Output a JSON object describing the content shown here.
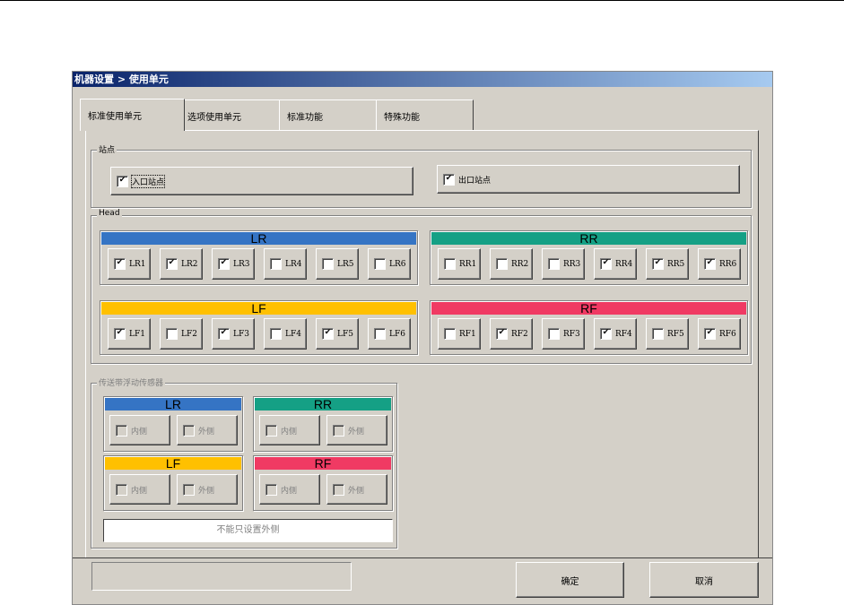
{
  "window": {
    "title": "机器设置 > 使用单元"
  },
  "tabs": [
    {
      "label": "标准使用单元",
      "active": true
    },
    {
      "label": "选项使用单元"
    },
    {
      "label": "标准功能"
    },
    {
      "label": "特殊功能"
    }
  ],
  "stations": {
    "legend": "站点",
    "entry": {
      "label": "入口站点",
      "checked": true
    },
    "exit": {
      "label": "出口站点",
      "checked": true
    }
  },
  "head": {
    "legend": "Head",
    "groups": [
      {
        "name": "LR",
        "color": "#3574c4",
        "items": [
          [
            "LR1",
            true
          ],
          [
            "LR2",
            true
          ],
          [
            "LR3",
            true
          ],
          [
            "LR4",
            false
          ],
          [
            "LR5",
            false
          ],
          [
            "LR6",
            false
          ]
        ]
      },
      {
        "name": "RR",
        "color": "#15a085",
        "items": [
          [
            "RR1",
            false
          ],
          [
            "RR2",
            false
          ],
          [
            "RR3",
            false
          ],
          [
            "RR4",
            true
          ],
          [
            "RR5",
            true
          ],
          [
            "RR6",
            true
          ]
        ]
      },
      {
        "name": "LF",
        "color": "#ffc000",
        "items": [
          [
            "LF1",
            true
          ],
          [
            "LF2",
            false
          ],
          [
            "LF3",
            true
          ],
          [
            "LF4",
            false
          ],
          [
            "LF5",
            true
          ],
          [
            "LF6",
            false
          ]
        ]
      },
      {
        "name": "RF",
        "color": "#f03a63",
        "items": [
          [
            "RF1",
            false
          ],
          [
            "RF2",
            true
          ],
          [
            "RF3",
            false
          ],
          [
            "RF4",
            true
          ],
          [
            "RF5",
            false
          ],
          [
            "RF6",
            true
          ]
        ]
      }
    ]
  },
  "sensor": {
    "legend": "传送带浮动传感器",
    "inner_label": "内侧",
    "outer_label": "外侧",
    "groups": [
      {
        "name": "LR",
        "color": "#3574c4"
      },
      {
        "name": "RR",
        "color": "#15a085"
      },
      {
        "name": "LF",
        "color": "#ffc000"
      },
      {
        "name": "RF",
        "color": "#f03a63"
      }
    ],
    "message": "不能只设置外侧"
  },
  "buttons": {
    "ok": "确定",
    "cancel": "取消"
  },
  "check_glyph": "✔"
}
